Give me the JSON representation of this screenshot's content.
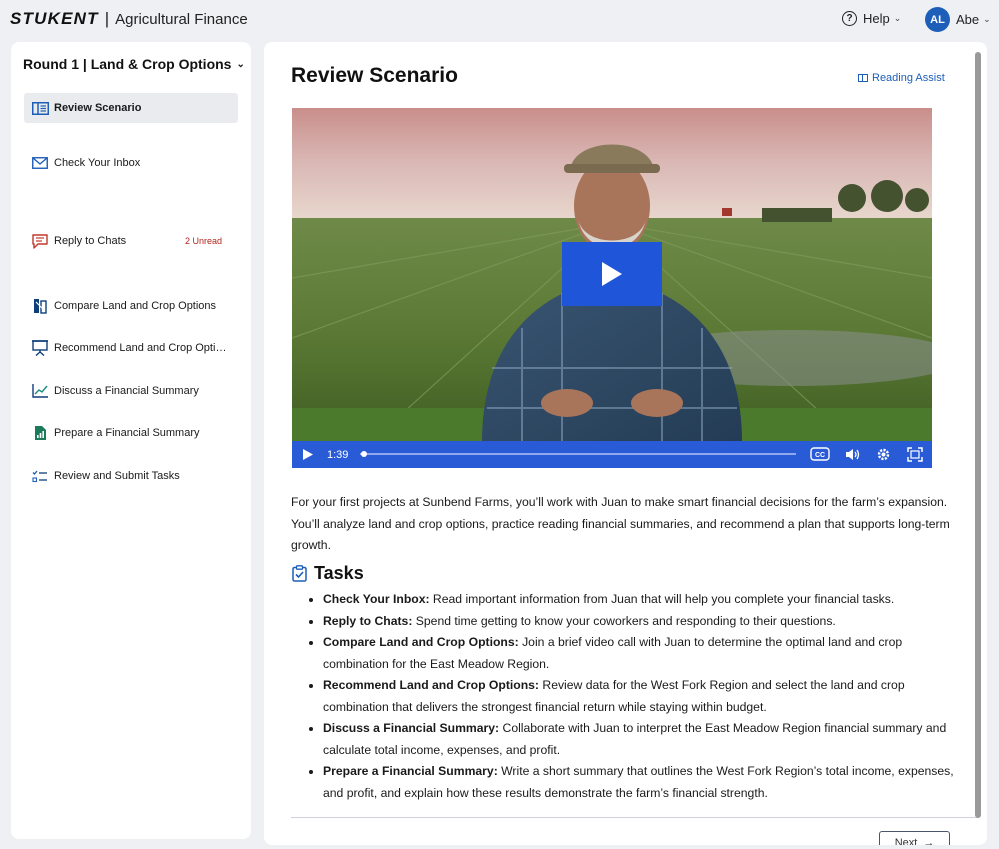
{
  "header": {
    "logo_text": "STUKENT",
    "separator": "|",
    "app_title": "Agricultural Finance",
    "help_label": "Help",
    "user_initials": "AL",
    "user_name": "Abe"
  },
  "sidebar": {
    "round_title": "Round 1 | Land & Crop Options",
    "items": [
      {
        "label": "Review Scenario",
        "icon": "book-icon",
        "active": true,
        "badge": ""
      },
      {
        "label": "Check Your Inbox",
        "icon": "mail-icon",
        "active": false,
        "badge": ""
      },
      {
        "label": "Reply to Chats",
        "icon": "chat-icon",
        "active": false,
        "badge": "2 Unread"
      },
      {
        "label": "Compare Land and Crop Options",
        "icon": "compare-icon",
        "active": false,
        "badge": ""
      },
      {
        "label": "Recommend Land and Crop Options",
        "icon": "presentation-icon",
        "active": false,
        "badge": ""
      },
      {
        "label": "Discuss a Financial Summary",
        "icon": "line-chart-icon",
        "active": false,
        "badge": ""
      },
      {
        "label": "Prepare a Financial Summary",
        "icon": "report-icon",
        "active": false,
        "badge": ""
      },
      {
        "label": "Review and Submit Tasks",
        "icon": "checklist-icon",
        "active": false,
        "badge": ""
      }
    ]
  },
  "main": {
    "page_title": "Review Scenario",
    "reading_assist": "Reading Assist",
    "video": {
      "current_time": "1:39",
      "progress": 0.01
    },
    "intro_text": "For your first projects at Sunbend Farms, you’ll work with Juan to make smart financial decisions for the farm’s expansion. You’ll analyze land and crop options, practice reading financial summaries, and recommend a plan that supports long-term growth.",
    "tasks_heading": "Tasks",
    "tasks": [
      {
        "title": "Check Your Inbox:",
        "text": " Read important information from Juan that will help you complete your financial tasks."
      },
      {
        "title": "Reply to Chats:",
        "text": " Spend time getting to know your coworkers and responding to their questions."
      },
      {
        "title": "Compare Land and Crop Options:",
        "text": " Join a brief video call with Juan to determine the optimal land and crop combination for the East Meadow Region."
      },
      {
        "title": "Recommend Land and Crop Options:",
        "text": " Review data for the West Fork Region and select the land and crop combination that delivers the strongest financial return while staying within budget."
      },
      {
        "title": "Discuss a Financial Summary:",
        "text": " Collaborate with Juan to interpret the East Meadow Region financial summary and calculate total income, expenses, and profit."
      },
      {
        "title": "Prepare a Financial Summary:",
        "text": " Write a short summary that outlines the West Fork Region’s total income, expenses, and profit, and explain how these results demonstrate the farm’s financial strength."
      }
    ],
    "next_label": "Next"
  },
  "colors": {
    "accent": "#1d5fb8",
    "video_controls": "#2a5bd7",
    "unread_badge": "#b3261e",
    "active_nav_bg": "#e9ebef"
  }
}
